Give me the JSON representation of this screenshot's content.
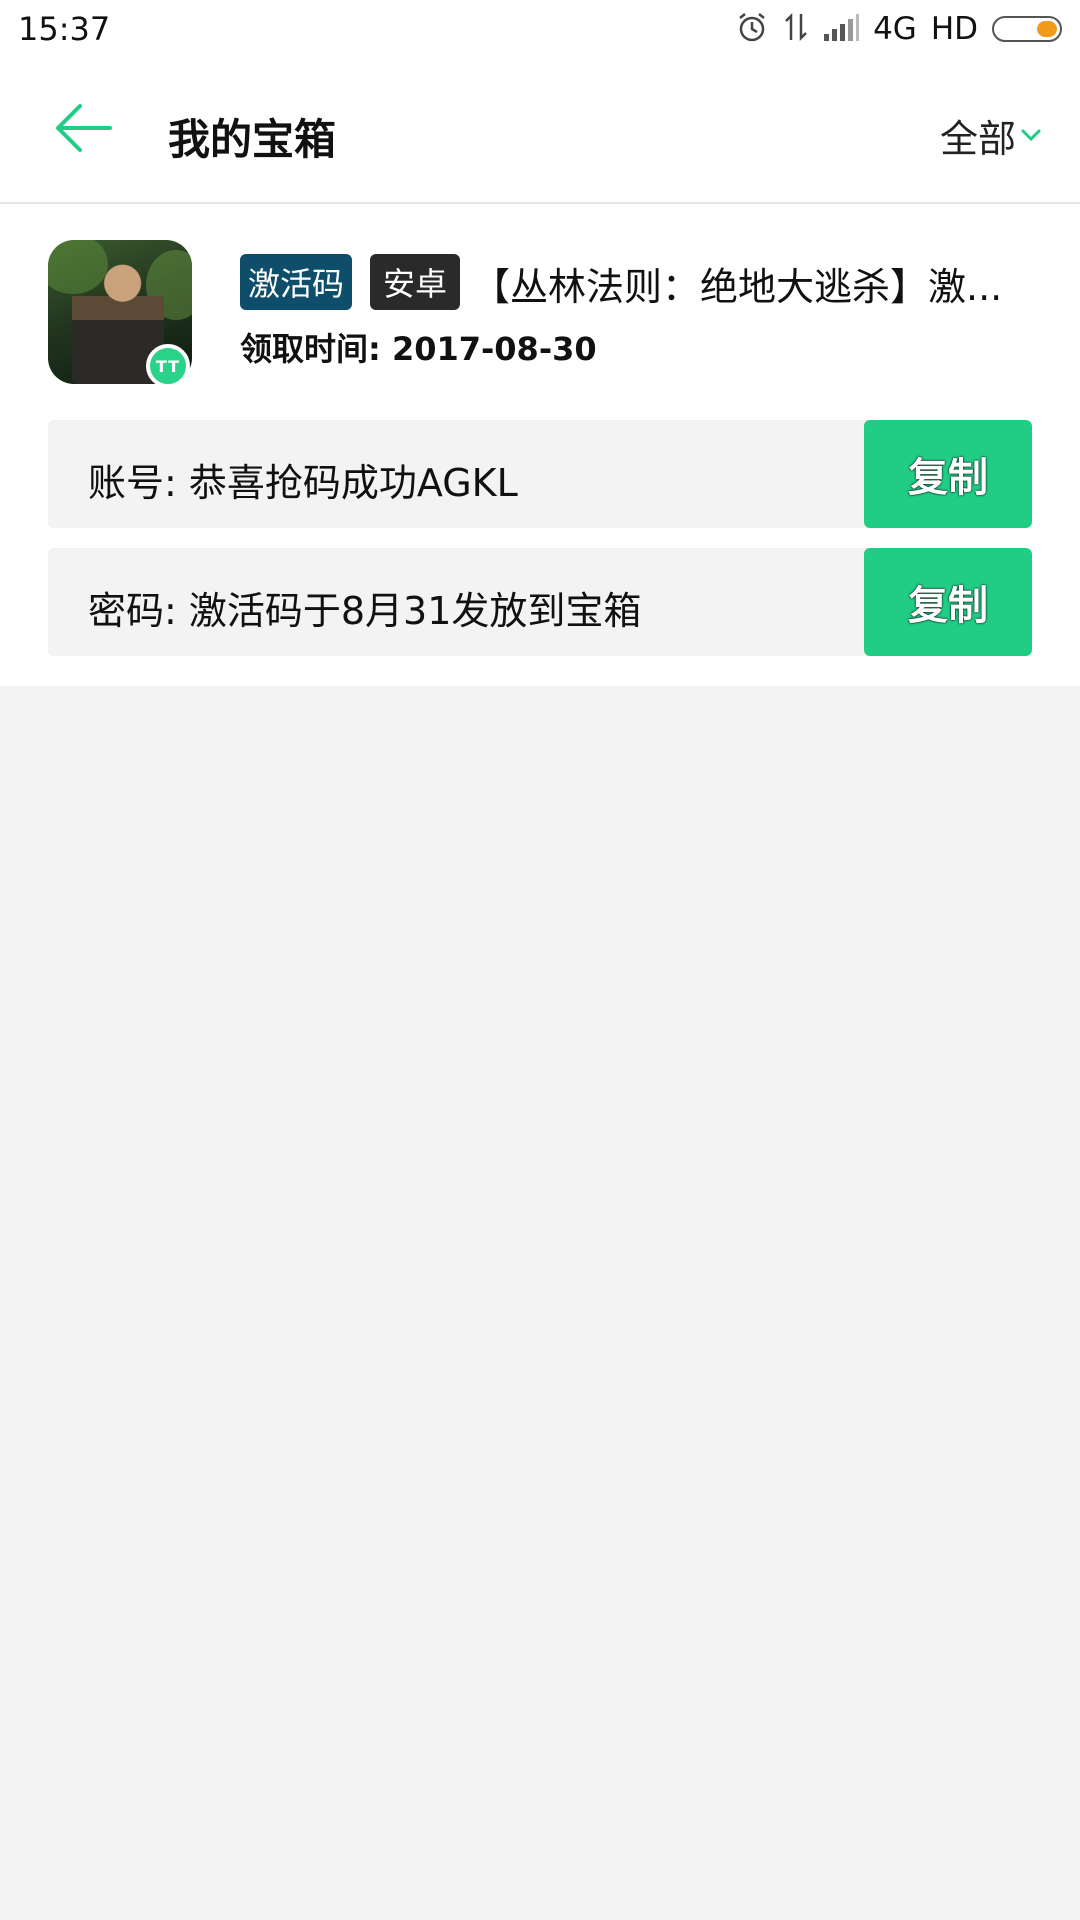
{
  "status_bar": {
    "time": "15:37",
    "network": "4G",
    "hd": "HD",
    "icons": [
      "alarm-icon",
      "data-transfer-icon",
      "signal-icon",
      "battery-icon"
    ],
    "battery_color": "#f39a1c"
  },
  "header": {
    "back_icon": "arrow-left-icon",
    "title": "我的宝箱",
    "filter_label": "全部",
    "filter_icon": "chevron-down-icon",
    "accent_color": "#21cc85"
  },
  "card": {
    "tags": [
      "激活码",
      "安卓"
    ],
    "title": "【丛林法则：绝地大逃杀】激...",
    "claim_time": "领取时间: 2017-08-30",
    "app_badge": "TT",
    "fields": [
      {
        "text": "账号: 恭喜抢码成功AGKL",
        "button": "复制"
      },
      {
        "text": "密码: 激活码于8月31发放到宝箱",
        "button": "复制"
      }
    ]
  }
}
